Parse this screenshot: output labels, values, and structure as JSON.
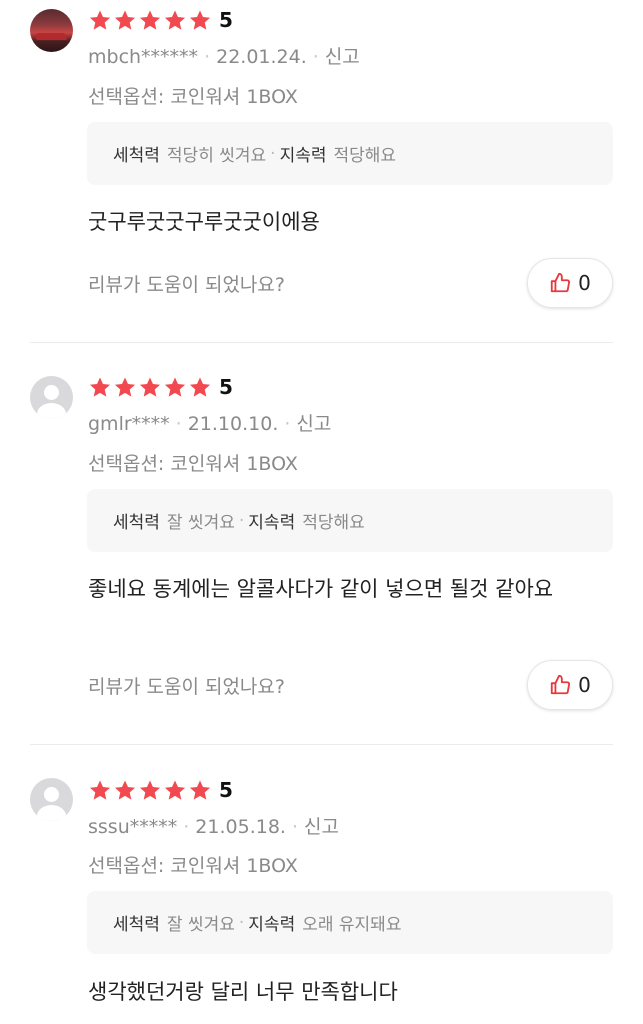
{
  "star_color": "#f2484f",
  "like_icon_color": "#e8383d",
  "labels": {
    "separator": "·"
  },
  "reviews": [
    {
      "avatar": "profile-photo",
      "score": "5",
      "user": "mbch******",
      "date": "22.01.24.",
      "report": "신고",
      "option": "선택옵션: 코인워셔 1BOX",
      "tag1_key": "세척력",
      "tag1_val": "적당히 씻겨요",
      "tag2_key": "지속력",
      "tag2_val": "적당해요",
      "text": "굿구루굿굿구루굿굿이에용",
      "helpful_q": "리뷰가 도움이 되었나요?",
      "likes": "0"
    },
    {
      "avatar": "default-user-icon",
      "score": "5",
      "user": "gmlr****",
      "date": "21.10.10.",
      "report": "신고",
      "option": "선택옵션: 코인워셔 1BOX",
      "tag1_key": "세척력",
      "tag1_val": "잘 씻겨요",
      "tag2_key": "지속력",
      "tag2_val": "적당해요",
      "text": "좋네요 동계에는 알콜사다가 같이 넣으면 될것 같아요",
      "helpful_q": "리뷰가 도움이 되었나요?",
      "likes": "0"
    },
    {
      "avatar": "default-user-icon",
      "score": "5",
      "user": "sssu*****",
      "date": "21.05.18.",
      "report": "신고",
      "option": "선택옵션: 코인워셔 1BOX",
      "tag1_key": "세척력",
      "tag1_val": "잘 씻겨요",
      "tag2_key": "지속력",
      "tag2_val": "오래 유지돼요",
      "text": "생각했던거랑 달리 너무 만족합니다"
    }
  ]
}
